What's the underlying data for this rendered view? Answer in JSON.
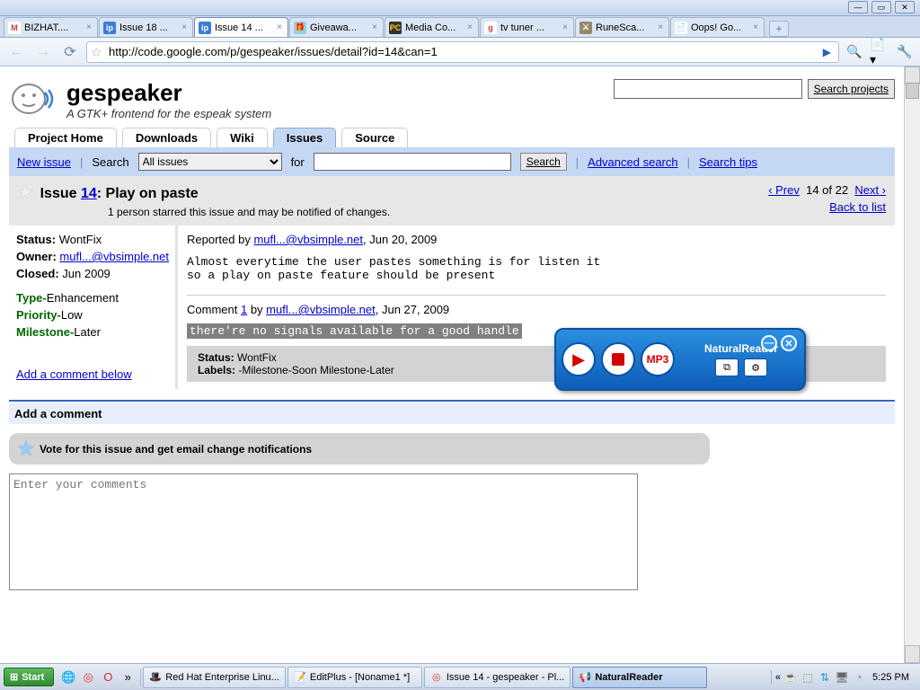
{
  "window": {
    "tabs": [
      "BIZHAT....",
      "Issue 18 ...",
      "Issue 14 ...",
      "Giveawa...",
      "Media Co...",
      "tv tuner ...",
      "RuneSca...",
      "Oops! Go..."
    ],
    "active_tab": 2,
    "url": "http://code.google.com/p/gespeaker/issues/detail?id=14&can=1"
  },
  "project": {
    "name": "gespeaker",
    "tagline": "A GTK+ frontend for the espeak system",
    "search_btn": "Search projects",
    "tabs": [
      "Project Home",
      "Downloads",
      "Wiki",
      "Issues",
      "Source"
    ],
    "active_tab": 3
  },
  "issue_bar": {
    "new_issue": "New issue",
    "search_label": "Search",
    "select_value": "All issues",
    "for_label": "for",
    "search_btn": "Search",
    "advanced": "Advanced search",
    "tips": "Search tips"
  },
  "issue_head": {
    "prefix": "Issue ",
    "num": "14",
    "title_rest": ": Play on paste",
    "starred": "1 person starred this issue and may be notified of changes.",
    "prev": "‹ Prev",
    "pos": "14 of 22",
    "next": "Next ›",
    "back": "Back to list"
  },
  "meta": {
    "status_l": "Status:",
    "status_v": "WontFix",
    "owner_l": "Owner:",
    "owner_v": "mufl...@vbsimple.net",
    "closed_l": "Closed:",
    "closed_v": "Jun 2009",
    "type": "Type-Enhancement",
    "priority": "Priority-Low",
    "milestone": "Milestone-Later",
    "add_comment": "Add a comment below"
  },
  "report": {
    "by_prefix": "Reported by ",
    "by_user": "mufl...@vbsimple.net",
    "by_date": ", Jun 20, 2009",
    "body": "Almost everytime the user pastes something is for listen it\nso a play on paste feature should be present"
  },
  "comment": {
    "prefix": "Comment ",
    "num": "1",
    "by": " by ",
    "user": "mufl...@vbsimple.net",
    "date": ", Jun 27, 2009",
    "highlight": "there're no signals available for a good handle",
    "status_l": "Status:",
    "status_v": "WontFix",
    "labels_l": "Labels:",
    "labels_v": "-Milestone-Soon Milestone-Later"
  },
  "nr": {
    "label": "NaturalReader",
    "mp3": "MP3"
  },
  "add_comment": {
    "head": "Add a comment",
    "vote": "Vote for this issue and get email change notifications",
    "placeholder": "Enter your comments"
  },
  "taskbar": {
    "start": "Start",
    "items": [
      "Red Hat Enterprise Linu...",
      "EditPlus - [Noname1 *]",
      "Issue 14 - gespeaker - Pl...",
      "NaturalReader"
    ],
    "active_item": 3,
    "clock": "5:25 PM"
  }
}
